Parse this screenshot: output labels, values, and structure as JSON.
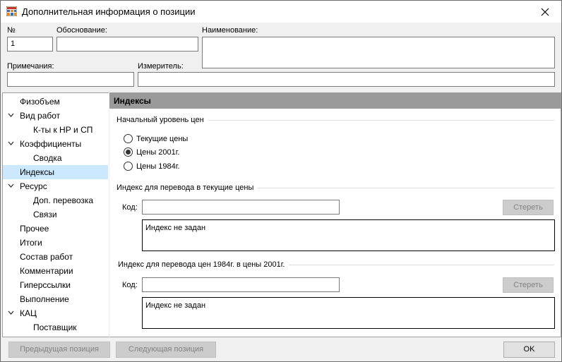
{
  "window": {
    "title": "Дополнительная информация о позиции"
  },
  "fields": {
    "number_label": "№",
    "number_value": "1",
    "basis_label": "Обоснование:",
    "basis_value": "",
    "name_label": "Наименование:",
    "name_value": "",
    "notes_label": "Примечания:",
    "notes_value": "",
    "meter_label": "Измеритель:",
    "meter_value": ""
  },
  "tree": {
    "items": [
      {
        "label": "Физобъем",
        "level": 0,
        "expandable": false,
        "selected": false
      },
      {
        "label": "Вид работ",
        "level": 0,
        "expandable": true,
        "selected": false
      },
      {
        "label": "К-ты к НР и СП",
        "level": 1,
        "expandable": false,
        "selected": false
      },
      {
        "label": "Коэффициенты",
        "level": 0,
        "expandable": true,
        "selected": false
      },
      {
        "label": "Сводка",
        "level": 1,
        "expandable": false,
        "selected": false
      },
      {
        "label": "Индексы",
        "level": 0,
        "expandable": false,
        "selected": true
      },
      {
        "label": "Ресурс",
        "level": 0,
        "expandable": true,
        "selected": false
      },
      {
        "label": "Доп. перевозка",
        "level": 1,
        "expandable": false,
        "selected": false
      },
      {
        "label": "Связи",
        "level": 1,
        "expandable": false,
        "selected": false
      },
      {
        "label": "Прочее",
        "level": 0,
        "expandable": false,
        "selected": false
      },
      {
        "label": "Итоги",
        "level": 0,
        "expandable": false,
        "selected": false
      },
      {
        "label": "Состав работ",
        "level": 0,
        "expandable": false,
        "selected": false
      },
      {
        "label": "Комментарии",
        "level": 0,
        "expandable": false,
        "selected": false
      },
      {
        "label": "Гиперссылки",
        "level": 0,
        "expandable": false,
        "selected": false
      },
      {
        "label": "Выполнение",
        "level": 0,
        "expandable": false,
        "selected": false
      },
      {
        "label": "КАЦ",
        "level": 0,
        "expandable": true,
        "selected": false
      },
      {
        "label": "Поставщик",
        "level": 1,
        "expandable": false,
        "selected": false
      }
    ]
  },
  "panel": {
    "title": "Индексы",
    "price_level": {
      "title": "Начальный уровень цен",
      "options": [
        "Текущие цены",
        "Цены 2001г.",
        "Цены 1984г."
      ],
      "selected_index": 1
    },
    "index_current": {
      "title": "Индекс для перевода в текущие цены",
      "code_label": "Код:",
      "code_value": "",
      "clear_label": "Стереть",
      "memo": "Индекс не задан"
    },
    "index_1984": {
      "title": "Индекс для перевода цен 1984г. в цены 2001г.",
      "code_label": "Код:",
      "code_value": "",
      "clear_label": "Стереть",
      "memo": "Индекс не задан"
    }
  },
  "footer": {
    "prev_label": "Предыдущая позиция",
    "next_label": "Следующая позиция",
    "ok_label": "OK"
  }
}
